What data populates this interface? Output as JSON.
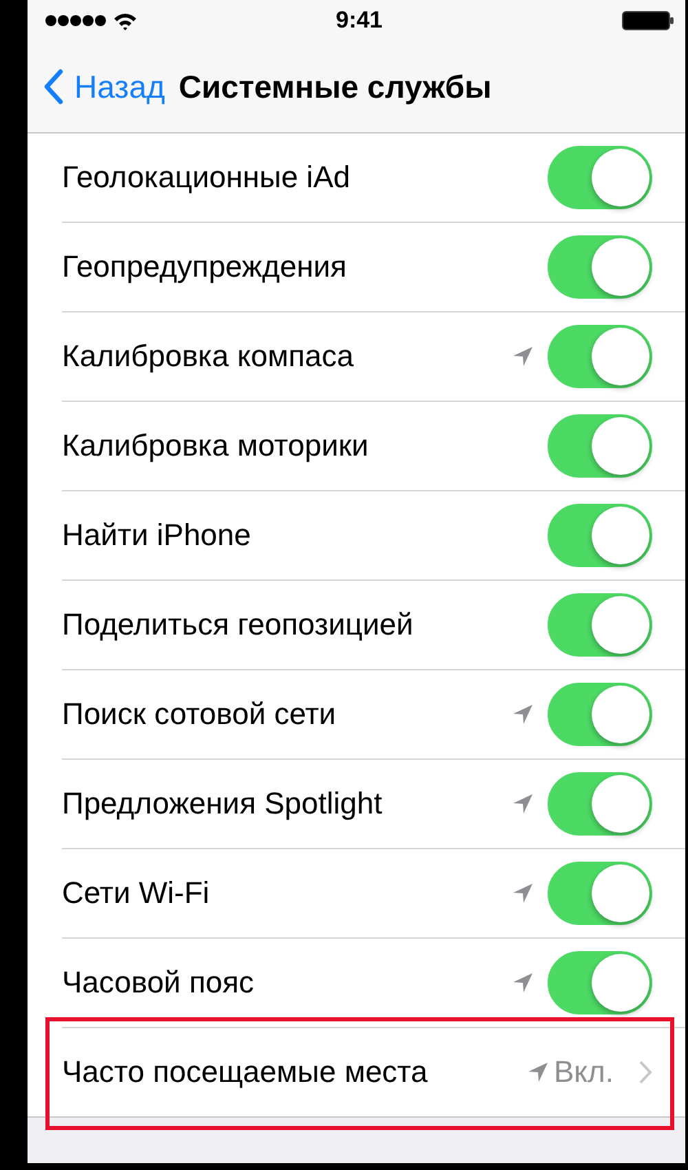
{
  "status_bar": {
    "time": "9:41"
  },
  "nav_bar": {
    "back_label": "Назад",
    "title": "Системные службы"
  },
  "settings": [
    {
      "kind": "toggle",
      "label": "Геолокационные iAd",
      "location_indicator": false,
      "on": true,
      "highlighted": false
    },
    {
      "kind": "toggle",
      "label": "Геопредупреждения",
      "location_indicator": false,
      "on": true,
      "highlighted": false
    },
    {
      "kind": "toggle",
      "label": "Калибровка компаса",
      "location_indicator": true,
      "on": true,
      "highlighted": false
    },
    {
      "kind": "toggle",
      "label": "Калибровка моторики",
      "location_indicator": false,
      "on": true,
      "highlighted": false
    },
    {
      "kind": "toggle",
      "label": "Найти iPhone",
      "location_indicator": false,
      "on": true,
      "highlighted": false
    },
    {
      "kind": "toggle",
      "label": "Поделиться геопозицией",
      "location_indicator": false,
      "on": true,
      "highlighted": false
    },
    {
      "kind": "toggle",
      "label": "Поиск сотовой сети",
      "location_indicator": true,
      "on": true,
      "highlighted": false
    },
    {
      "kind": "toggle",
      "label": "Предложения Spotlight",
      "location_indicator": true,
      "on": true,
      "highlighted": false
    },
    {
      "kind": "toggle",
      "label": "Сети Wi-Fi",
      "location_indicator": true,
      "on": true,
      "highlighted": false
    },
    {
      "kind": "toggle",
      "label": "Часовой пояс",
      "location_indicator": true,
      "on": true,
      "highlighted": false
    },
    {
      "kind": "detail",
      "label": "Часто посещаемые места",
      "location_indicator": true,
      "value": "Вкл.",
      "highlighted": true
    }
  ]
}
